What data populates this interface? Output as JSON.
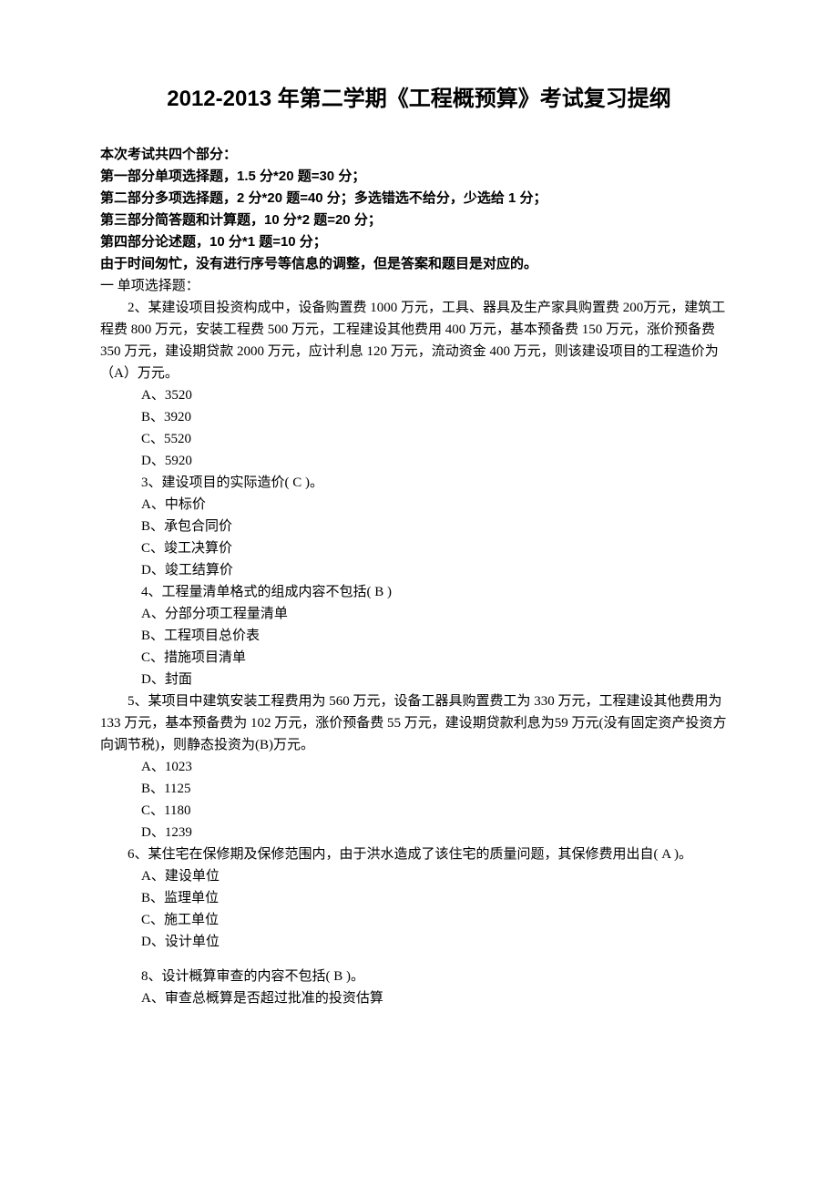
{
  "title": "2012-2013 年第二学期《工程概预算》考试复习提纲",
  "intro": {
    "l1": "本次考试共四个部分：",
    "l2": "第一部分单项选择题，1.5 分*20 题=30 分；",
    "l3": "第二部分多项选择题，2 分*20 题=40 分；多选错选不给分，少选给 1 分；",
    "l4": "第三部分简答题和计算题，10 分*2 题=20 分；",
    "l5": "第四部分论述题，10 分*1 题=10 分；",
    "l6": "由于时间匆忙，没有进行序号等信息的调整，但是答案和题目是对应的。"
  },
  "sec1": "一  单项选择题：",
  "q2": {
    "text": "2、某建设项目投资构成中，设备购置费 1000 万元，工具、器具及生产家具购置费 200万元，建筑工程费 800 万元，安装工程费 500 万元，工程建设其他费用 400 万元，基本预备费 150 万元，涨价预备费 350 万元，建设期贷款 2000 万元，应计利息 120 万元，流动资金 400 万元，则该建设项目的工程造价为（A）万元。",
    "a": "A、3520",
    "b": "B、3920",
    "c": "C、5520",
    "d": "D、5920"
  },
  "q3": {
    "text": "3、建设项目的实际造价( C )。",
    "a": "A、中标价",
    "b": "B、承包合同价",
    "c": "C、竣工决算价",
    "d": "D、竣工结算价"
  },
  "q4": {
    "text": "4、工程量清单格式的组成内容不包括( B )",
    "a": "A、分部分项工程量清单",
    "b": "B、工程项目总价表",
    "c": "C、措施项目清单",
    "d": "D、封面"
  },
  "q5": {
    "text": "5、某项目中建筑安装工程费用为 560 万元，设备工器具购置费工为 330 万元，工程建设其他费用为 133 万元，基本预备费为 102 万元，涨价预备费 55 万元，建设期贷款利息为59 万元(没有固定资产投资方向调节税)，则静态投资为(B)万元。",
    "a": "A、1023",
    "b": "B、1125",
    "c": "C、1180",
    "d": "D、1239"
  },
  "q6": {
    "text": "6、某住宅在保修期及保修范围内，由于洪水造成了该住宅的质量问题，其保修费用出自( A )。",
    "a": "A、建设单位",
    "b": "B、监理单位",
    "c": "C、施工单位",
    "d": "D、设计单位"
  },
  "q8": {
    "text": "8、设计概算审查的内容不包括( B )。",
    "a": "A、审查总概算是否超过批准的投资估算"
  }
}
